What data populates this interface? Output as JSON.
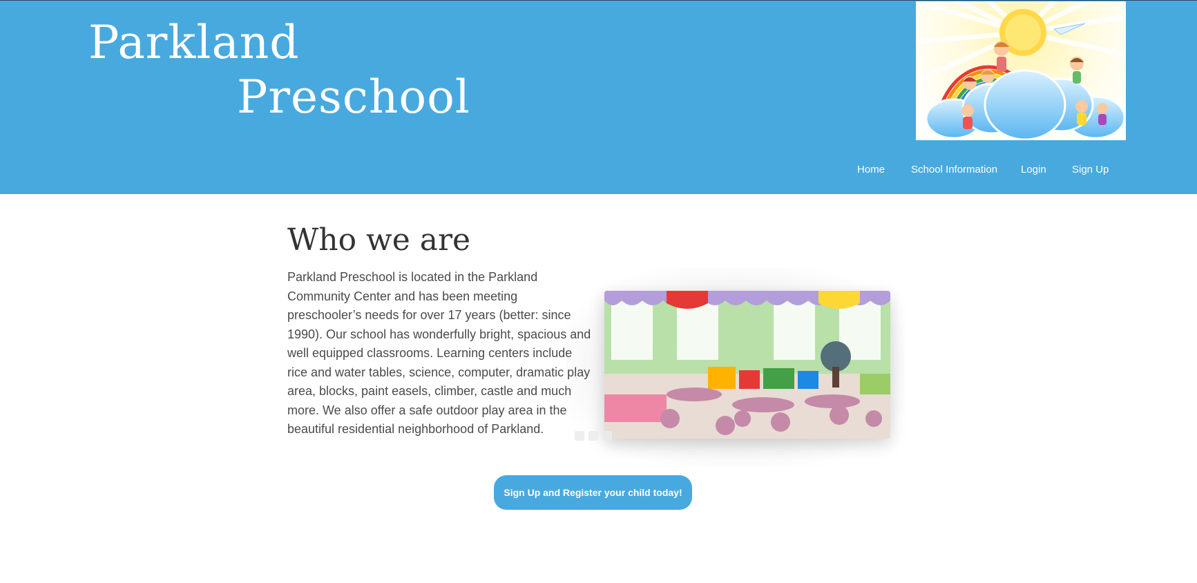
{
  "header": {
    "brand_line1": "Parkland",
    "brand_line2": "Preschool",
    "logo_icon": "preschool-rainbow-clouds-logo"
  },
  "nav": {
    "items": [
      {
        "label": "Home"
      },
      {
        "label": "School Information"
      },
      {
        "label": "Login"
      },
      {
        "label": "Sign Up"
      }
    ]
  },
  "main": {
    "title": "Who we are",
    "body": "Parkland Preschool is located in the Parkland Community Center and has been meeting preschooler’s needs for over 17 years (better: since 1990).  Our school has wonderfully bright, spacious and well equipped classrooms.  Learning centers include rice and water tables, science, computer, dramatic play area, blocks, paint easels, climber, castle and much more.  We also offer a safe outdoor play area in the beautiful residential neighborhood of Parkland.",
    "photo_icon": "classroom-photo",
    "cta_label": "Sign Up and Register your child today!"
  },
  "colors": {
    "brand_blue": "#48a9df",
    "heading": "#333333",
    "body_text": "#4a4a4a"
  }
}
